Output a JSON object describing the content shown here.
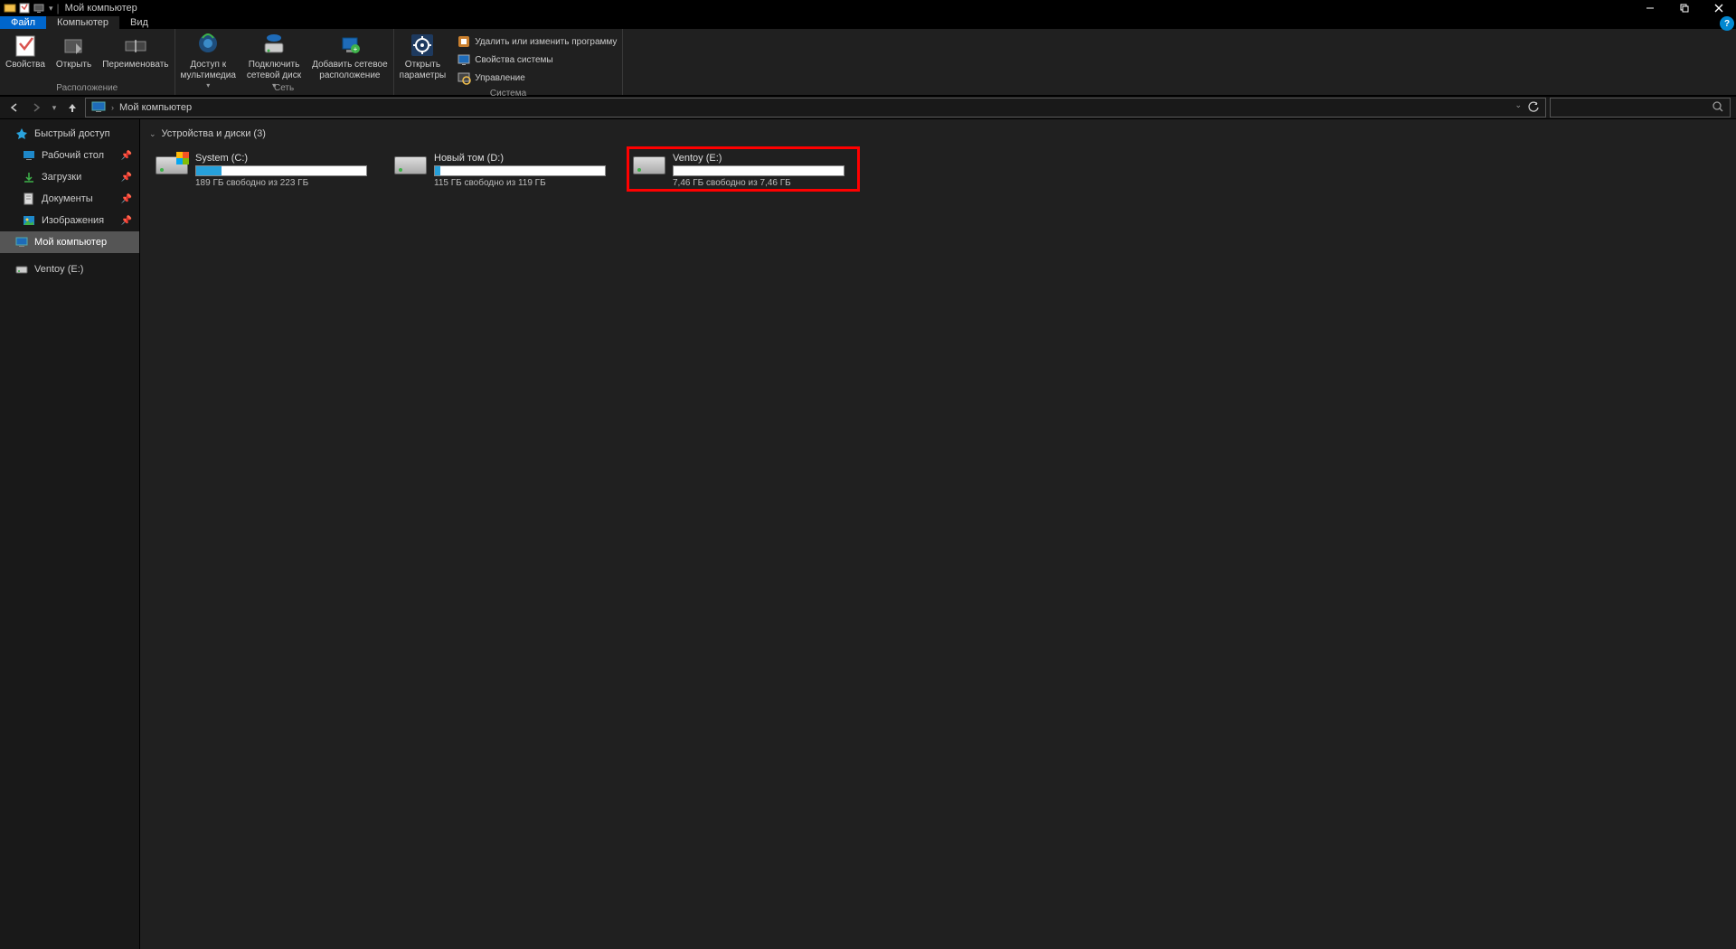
{
  "title": "Мой компьютер",
  "tabs": {
    "file": "Файл",
    "computer": "Компьютер",
    "view": "Вид"
  },
  "ribbon": {
    "group_location": "Расположение",
    "group_network": "Сеть",
    "group_system": "Система",
    "properties": "Свойства",
    "open": "Открыть",
    "rename": "Переименовать",
    "media_access": "Доступ к\nмультимедиа",
    "map_drive": "Подключить\nсетевой диск",
    "add_netloc": "Добавить сетевое\nрасположение",
    "open_params": "Открыть\nпараметры",
    "uninstall": "Удалить или изменить программу",
    "sys_props": "Свойства системы",
    "management": "Управление"
  },
  "addr": {
    "path": "Мой компьютер"
  },
  "sidebar": {
    "quick_access": "Быстрый доступ",
    "desktop": "Рабочий стол",
    "downloads": "Загрузки",
    "documents": "Документы",
    "pictures": "Изображения",
    "this_pc": "Мой компьютер",
    "ventoy": "Ventoy (E:)"
  },
  "content": {
    "group_header": "Устройства и диски (3)",
    "drives": [
      {
        "name": "System (C:)",
        "free": "189 ГБ свободно из 223 ГБ",
        "fill_pct": 15,
        "fill_color": "#26a0da",
        "win": true,
        "highlight": false
      },
      {
        "name": "Новый том (D:)",
        "free": "115 ГБ свободно из 119 ГБ",
        "fill_pct": 3,
        "fill_color": "#26a0da",
        "win": false,
        "highlight": false
      },
      {
        "name": "Ventoy (E:)",
        "free": "7,46 ГБ свободно из 7,46 ГБ",
        "fill_pct": 0,
        "fill_color": "#26a0da",
        "win": false,
        "highlight": true
      }
    ]
  }
}
